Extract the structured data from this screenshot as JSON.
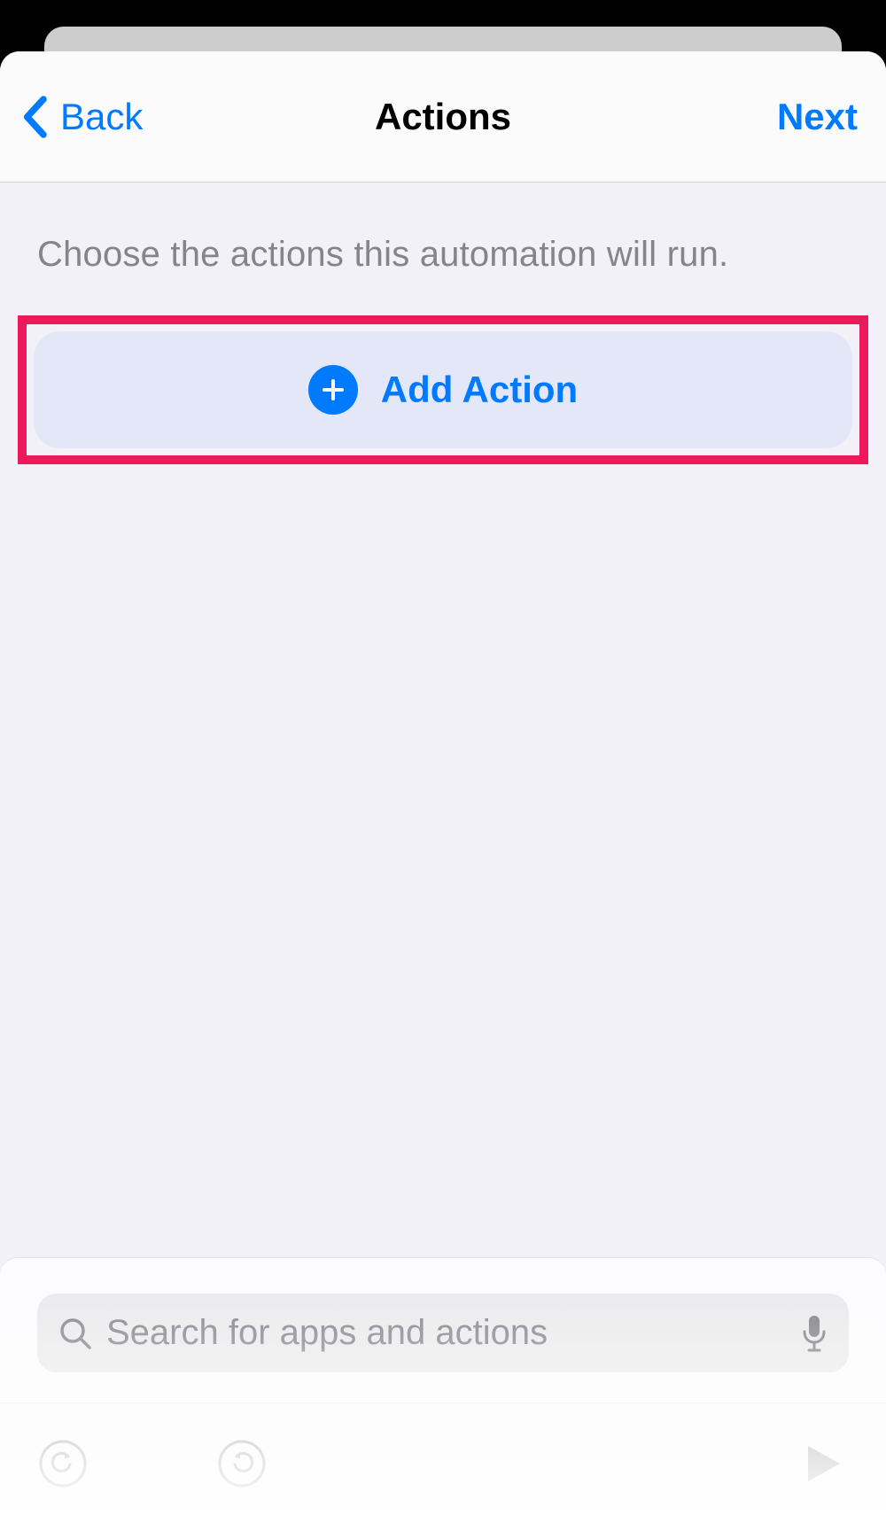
{
  "nav": {
    "back_label": "Back",
    "title": "Actions",
    "next_label": "Next"
  },
  "content": {
    "instruction": "Choose the actions this automation will run.",
    "add_action_label": "Add Action"
  },
  "search": {
    "placeholder": "Search for apps and actions"
  }
}
